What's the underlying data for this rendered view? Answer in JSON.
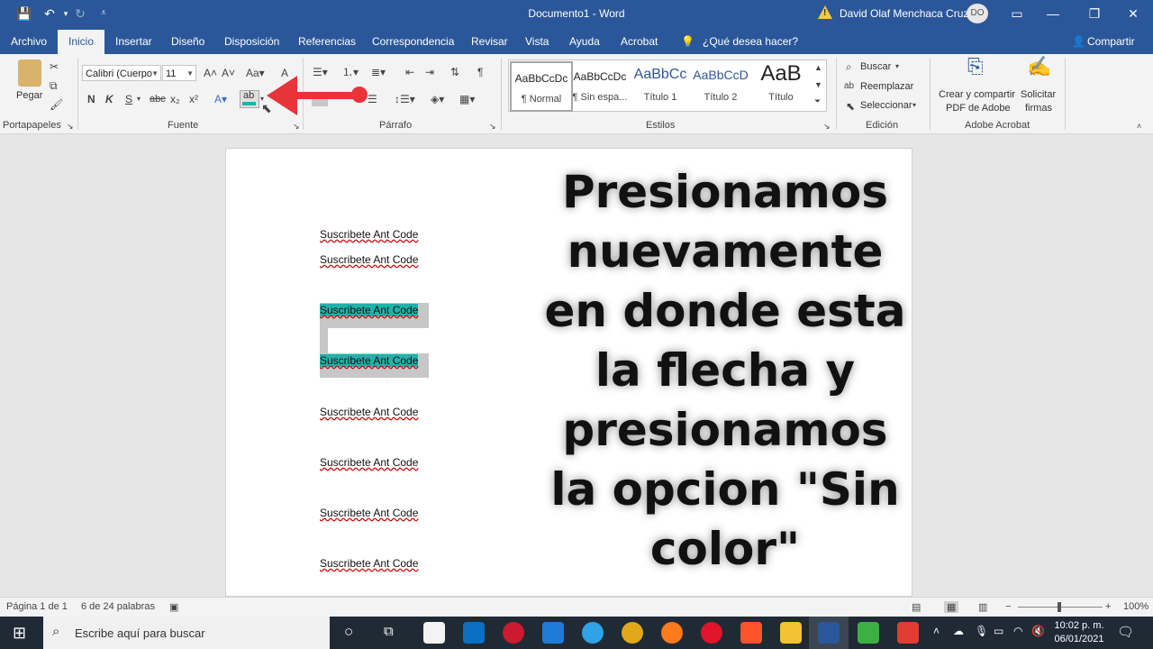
{
  "titlebar": {
    "title": "Documento1 - Word",
    "user": "David Olaf Menchaca Cruz",
    "initials": "DO"
  },
  "tabs": [
    "Archivo",
    "Inicio",
    "Insertar",
    "Diseño",
    "Disposición",
    "Referencias",
    "Correspondencia",
    "Revisar",
    "Vista",
    "Ayuda",
    "Acrobat"
  ],
  "tell_me": "¿Qué desea hacer?",
  "share": "Compartir",
  "ribbon": {
    "clipboard": {
      "paste": "Pegar",
      "label": "Portapapeles"
    },
    "font": {
      "name": "Calibri (Cuerpo",
      "size": "11",
      "bold": "N",
      "italic": "K",
      "underline": "S",
      "strike": "abc",
      "sub": "x₂",
      "sup": "x²",
      "label": "Fuente"
    },
    "paragraph": {
      "label": "Párrafo"
    },
    "styles": {
      "label": "Estilos",
      "items": [
        {
          "sample": "AaBbCcDc",
          "name": "¶ Normal"
        },
        {
          "sample": "AaBbCcDc",
          "name": "¶ Sin espa..."
        },
        {
          "sample": "AaBbCc",
          "name": "Título 1"
        },
        {
          "sample": "AaBbCcD",
          "name": "Título 2"
        },
        {
          "sample": "AaB",
          "name": "Título"
        }
      ]
    },
    "editing": {
      "find": "Buscar",
      "replace": "Reemplazar",
      "select": "Seleccionar",
      "label": "Edición"
    },
    "acrobat": {
      "create": "Crear y compartir",
      "create2": "PDF de Adobe",
      "sign": "Solicitar",
      "sign2": "firmas",
      "label": "Adobe Acrobat"
    }
  },
  "document": {
    "lines": [
      "Suscribete Ant Code",
      "Suscribete Ant Code",
      "Suscribete Ant Code",
      "Suscribete Ant Code",
      "Suscribete Ant Code",
      "Suscribete Ant Code",
      "Suscribete Ant Code",
      "Suscribete Ant Code"
    ],
    "overlay": "Presionamos nuevamente en donde esta la flecha y presionamos la opcion \"Sin color\""
  },
  "status": {
    "page": "Página 1 de 1",
    "words": "6 de 24 palabras",
    "zoom": "100%"
  },
  "taskbar": {
    "search": "Escribe aquí para buscar",
    "time": "10:02 p. m.",
    "date": "06/01/2021"
  },
  "colors": {
    "word_blue": "#2b579a",
    "highlight": "#20b2aa",
    "arrow": "#e8333a"
  }
}
